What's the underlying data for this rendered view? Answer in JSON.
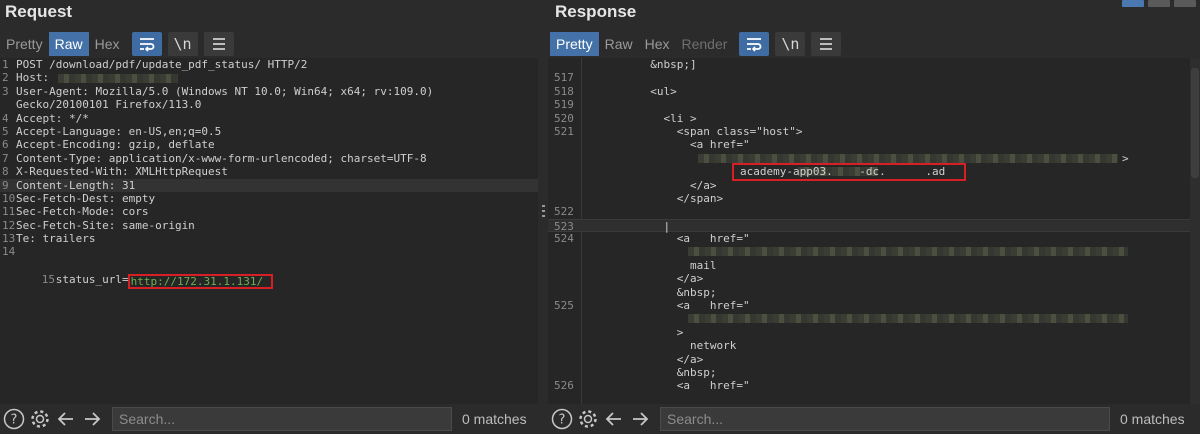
{
  "request": {
    "title": "Request",
    "tabs": [
      {
        "label": "Pretty",
        "state": "inactive"
      },
      {
        "label": "Raw",
        "state": "active"
      },
      {
        "label": "Hex",
        "state": "inactive"
      }
    ],
    "tools": {
      "wrap_icon": "wrap-lines-icon",
      "newline_label": "\\n",
      "menu_icon": "hamburger-menu-icon"
    },
    "lines": [
      {
        "n": "1",
        "text": "POST /download/pdf/update_pdf_status/ HTTP/2"
      },
      {
        "n": "2",
        "text": "Host: "
      },
      {
        "n": "3",
        "text": "User-Agent: Mozilla/5.0 (Windows NT 10.0; Win64; x64; rv:109.0)"
      },
      {
        "n": "",
        "text": "Gecko/20100101 Firefox/113.0"
      },
      {
        "n": "4",
        "text": "Accept: */*"
      },
      {
        "n": "5",
        "text": "Accept-Language: en-US,en;q=0.5"
      },
      {
        "n": "6",
        "text": "Accept-Encoding: gzip, deflate"
      },
      {
        "n": "7",
        "text": "Content-Type: application/x-www-form-urlencoded; charset=UTF-8"
      },
      {
        "n": "8",
        "text": "X-Requested-With: XMLHttpRequest"
      },
      {
        "n": "9",
        "text": "Content-Length: 31"
      },
      {
        "n": "10",
        "text": "Sec-Fetch-Dest: empty"
      },
      {
        "n": "11",
        "text": "Sec-Fetch-Mode: cors"
      },
      {
        "n": "12",
        "text": "Sec-Fetch-Site: same-origin"
      },
      {
        "n": "13",
        "text": "Te: trailers"
      },
      {
        "n": "14",
        "text": ""
      }
    ],
    "body_line": {
      "n": "15",
      "key": "status_url=",
      "value": "http://172.31.1.131/"
    },
    "search": {
      "placeholder": "Search...",
      "matches": "0 matches"
    }
  },
  "response": {
    "title": "Response",
    "tabs": [
      {
        "label": "Pretty",
        "state": "active"
      },
      {
        "label": "Raw",
        "state": "inactive"
      },
      {
        "label": "Hex",
        "state": "inactive"
      },
      {
        "label": "Render",
        "state": "disabled"
      }
    ],
    "lines": [
      {
        "n": "",
        "text": "          &nbsp;]"
      },
      {
        "n": "517",
        "text": ""
      },
      {
        "n": "518",
        "text": "          <ul>"
      },
      {
        "n": "519",
        "text": ""
      },
      {
        "n": "520",
        "text": "            <li >"
      },
      {
        "n": "521",
        "text": "              <span class=\"host\">"
      },
      {
        "n": "",
        "text": "                <a href=\""
      },
      {
        "n": "",
        "text": ""
      },
      {
        "n": "",
        "text": ""
      },
      {
        "n": "",
        "text": "                </a>"
      },
      {
        "n": "",
        "text": "              </span>"
      },
      {
        "n": "522",
        "text": ""
      },
      {
        "n": "523",
        "text": "            |"
      },
      {
        "n": "524",
        "text": "              <a   href=\""
      },
      {
        "n": "",
        "text": ""
      },
      {
        "n": "",
        "text": "                mail"
      },
      {
        "n": "",
        "text": "              </a>"
      },
      {
        "n": "",
        "text": "              &nbsp;"
      },
      {
        "n": "525",
        "text": "              <a   href=\""
      },
      {
        "n": "",
        "text": ""
      },
      {
        "n": "",
        "text": "              >"
      },
      {
        "n": "",
        "text": "                network"
      },
      {
        "n": "",
        "text": "              </a>"
      },
      {
        "n": "",
        "text": "              &nbsp;"
      },
      {
        "n": "526",
        "text": "              <a   href=\""
      }
    ],
    "host_text": "academy-app03.    -dc.      .ad",
    "search": {
      "placeholder": "Search...",
      "matches": "0 matches"
    }
  },
  "colors": {
    "accent": "#4472a8",
    "highlight_box": "#d91f26",
    "url_green": "#6ab14f"
  }
}
